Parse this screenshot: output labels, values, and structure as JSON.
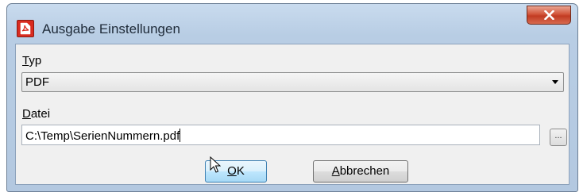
{
  "window": {
    "title": "Ausgabe Einstellungen",
    "icon": "pdf-app-icon",
    "close_icon": "close-x-icon"
  },
  "form": {
    "typ_label_first": "T",
    "typ_label_rest": "yp",
    "typ_value": "PDF",
    "datei_label_first": "D",
    "datei_label_rest": "atei",
    "datei_value": "C:\\Temp\\SerienNummern.pdf",
    "browse_label": "..."
  },
  "buttons": {
    "ok_first": "O",
    "ok_rest": "K",
    "cancel_first": "A",
    "cancel_rest": "bbrechen"
  },
  "colors": {
    "title_bar": "#c9dbee",
    "close_button": "#c13b22",
    "ok_button_border": "#3c7fb1",
    "client_background": "#f0f0f0"
  }
}
